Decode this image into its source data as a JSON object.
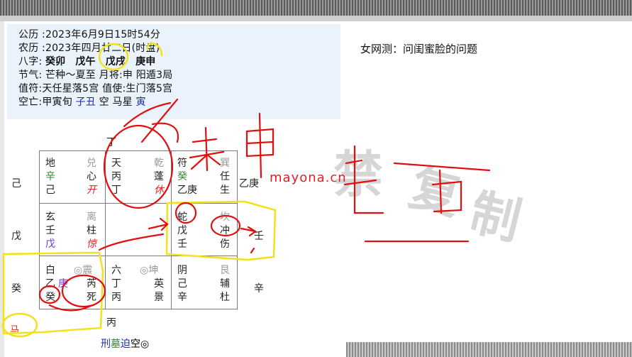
{
  "info": {
    "gongli": "公历 :2023年6月9日15时54分",
    "nongli": "农历 :2023年四月廿二日(时盘)",
    "bazi_label": "八字:",
    "bazi": [
      "癸卯",
      "戊午",
      "戊戌",
      "庚申"
    ],
    "jieqi": "节气: 芒种～夏至 月将:申 阳遁3局",
    "zhifu": "值符:天任星落5宫 值使:生门落5宫",
    "kongwang_prefix": "空亡:甲寅旬",
    "kongwang_kong": "子丑",
    "kongwang_mid": "空 马星",
    "kongwang_ma": "寅"
  },
  "question": "女网测：问闺蜜脸的问题",
  "watermark": "mayona.cn",
  "top_label": "丁",
  "bottom_label": "丙",
  "side_labels": {
    "left": [
      "己",
      "戊",
      "癸"
    ],
    "right": [
      "乙庚",
      "壬",
      "辛"
    ]
  },
  "palaces": [
    {
      "god": "地",
      "gua": "兑",
      "stem": "辛",
      "star": "心",
      "stem2": "己",
      "door": "开"
    },
    {
      "god": "天",
      "gua": "乾",
      "stem": "丙",
      "star": "蓬",
      "stem2": "丁",
      "door": "休"
    },
    {
      "god": "符",
      "gua": "巽",
      "stem": "癸",
      "star": "任",
      "stem2": "乙庚",
      "door": "生"
    },
    {
      "god": "玄",
      "gua": "离",
      "stem": "壬",
      "star": "柱",
      "stem2": "戊",
      "door": "惊"
    },
    {
      "god": "蛇",
      "gua": "坎",
      "stem": "戊",
      "star": "冲",
      "stem2": "壬",
      "door": "伤"
    },
    {
      "god": "白",
      "gua": "◎震",
      "stem": "乙",
      "stem_extra": "庚",
      "star": "芮",
      "stem2": "癸",
      "door": "死"
    },
    {
      "god": "六",
      "gua": "◎坤",
      "stem": "丁",
      "star": "英",
      "stem2": "丙",
      "door": "景"
    },
    {
      "god": "阴",
      "gua": "艮",
      "stem": "己",
      "star": "辅",
      "stem2": "辛",
      "door": "杜"
    }
  ],
  "horse_label": "马",
  "status_marks": [
    "刑",
    "墓",
    "迫",
    "空",
    "◎"
  ],
  "overlay_text": [
    "未",
    "申"
  ],
  "colors": {
    "blue": "#1a2fa8",
    "green": "#2e8b2e",
    "red": "#e02020",
    "purple": "#6a3fc2",
    "ink_red": "#e01010",
    "ink_yellow": "#f2e21a"
  }
}
